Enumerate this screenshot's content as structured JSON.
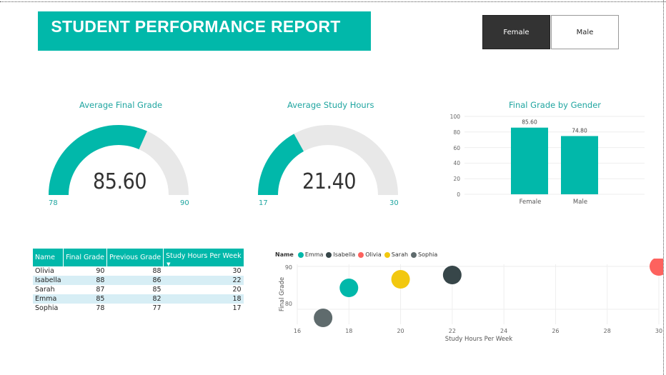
{
  "title": "STUDENT PERFORMANCE REPORT",
  "slicer": {
    "options": [
      "Female",
      "Male"
    ],
    "selected": "Female"
  },
  "colors": {
    "accent": "#01B8AA",
    "track": "#E8E8E8",
    "selected_slicer": "#333333"
  },
  "gauge_final": {
    "title": "Average Final Grade",
    "value": "85.60",
    "min": "78",
    "max": "90",
    "num": 85.6,
    "lo": 78,
    "hi": 90
  },
  "gauge_hours": {
    "title": "Average Study Hours",
    "value": "21.40",
    "min": "17",
    "max": "30",
    "num": 21.4,
    "lo": 17,
    "hi": 30
  },
  "bar_chart": {
    "title": "Final Grade by Gender",
    "yticks": [
      "100",
      "80",
      "60",
      "40",
      "20",
      "0"
    ],
    "labels": [
      "85.60",
      "74.80"
    ],
    "categories": [
      "Female",
      "Male"
    ]
  },
  "table": {
    "columns": [
      "Name",
      "Final Grade",
      "Previous Grade",
      "Study Hours Per Week"
    ],
    "rows": [
      [
        "Olivia",
        "90",
        "88",
        "30"
      ],
      [
        "Isabella",
        "88",
        "86",
        "22"
      ],
      [
        "Sarah",
        "87",
        "85",
        "20"
      ],
      [
        "Emma",
        "85",
        "82",
        "18"
      ],
      [
        "Sophia",
        "78",
        "77",
        "17"
      ]
    ]
  },
  "scatter": {
    "legend_title": "Name",
    "legend": [
      {
        "name": "Emma",
        "color": "#01B8AA"
      },
      {
        "name": "Isabella",
        "color": "#374649"
      },
      {
        "name": "Olivia",
        "color": "#FD625E"
      },
      {
        "name": "Sarah",
        "color": "#F2C80F"
      },
      {
        "name": "Sophia",
        "color": "#5F6B6D"
      }
    ],
    "xlabel": "Study Hours Per Week",
    "ylabel": "Final Grade",
    "xticks": [
      "16",
      "18",
      "20",
      "22",
      "24",
      "26",
      "28",
      "30"
    ],
    "yticks": [
      "90",
      "80"
    ]
  },
  "chart_data": [
    {
      "type": "bar",
      "title": "Final Grade by Gender",
      "categories": [
        "Female",
        "Male"
      ],
      "values": [
        85.6,
        74.8
      ],
      "ylim": [
        0,
        100
      ],
      "grid": true
    },
    {
      "type": "scatter",
      "xlabel": "Study Hours Per Week",
      "ylabel": "Final Grade",
      "xlim": [
        16,
        30
      ],
      "ylim": [
        76.5,
        90.5
      ],
      "series": [
        {
          "name": "Emma",
          "x": [
            18
          ],
          "y": [
            85
          ]
        },
        {
          "name": "Isabella",
          "x": [
            22
          ],
          "y": [
            88
          ]
        },
        {
          "name": "Olivia",
          "x": [
            30
          ],
          "y": [
            90
          ]
        },
        {
          "name": "Sarah",
          "x": [
            20
          ],
          "y": [
            87
          ]
        },
        {
          "name": "Sophia",
          "x": [
            17
          ],
          "y": [
            78
          ]
        }
      ],
      "legend": "top-left"
    }
  ]
}
